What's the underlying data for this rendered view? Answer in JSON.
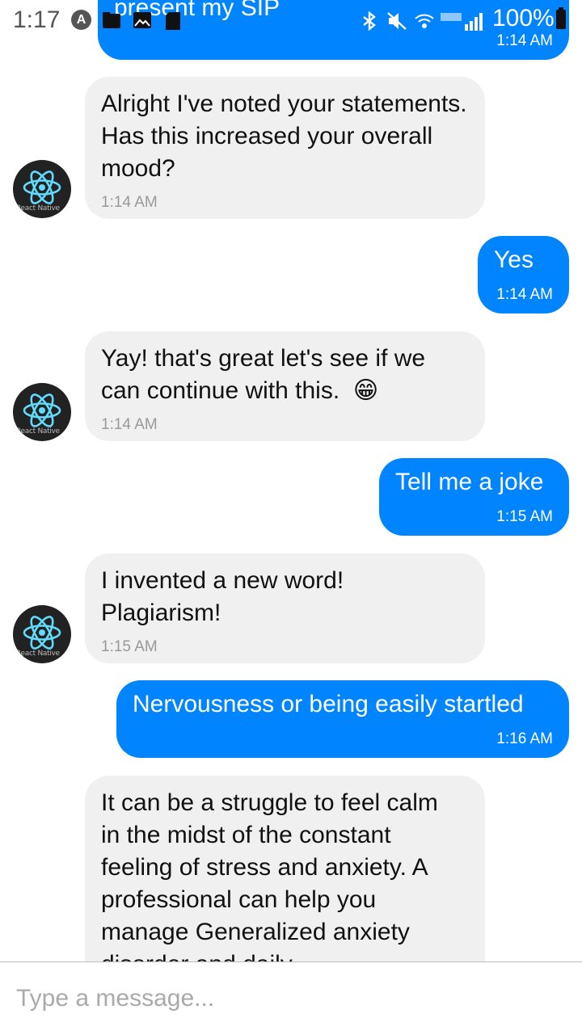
{
  "status_bar": {
    "time": "1:17",
    "notification_badge": "A",
    "battery": "100%",
    "icons": [
      "photo-icon",
      "image-icon",
      "sd-card-icon",
      "bluetooth-icon",
      "mute-icon",
      "wifi-icon",
      "signal-icon",
      "battery-icon"
    ]
  },
  "messages": [
    {
      "from": "user",
      "text": "present my SIP",
      "time": "1:14 AM"
    },
    {
      "from": "bot",
      "text": "Alright I've noted your statements. Has this increased your overall mood?",
      "time": "1:14 AM"
    },
    {
      "from": "user",
      "text": "Yes",
      "time": "1:14 AM"
    },
    {
      "from": "bot",
      "text": "Yay! that's great let's see if we can continue with this.",
      "emoji": "😁",
      "time": "1:14 AM"
    },
    {
      "from": "user",
      "text": "Tell me a joke",
      "time": "1:15 AM"
    },
    {
      "from": "bot",
      "text": "I invented a new word! Plagiarism!",
      "time": "1:15 AM"
    },
    {
      "from": "user",
      "text": "Nervousness or being easily startled",
      "time": "1:16 AM"
    },
    {
      "from": "bot",
      "text": "It can be a struggle to feel calm in the midst of the constant feeling of stress and anxiety. A professional can help you manage Generalized anxiety disorder and daily"
    }
  ],
  "avatar": {
    "caption": "React Native"
  },
  "composer": {
    "placeholder": "Type a message..."
  },
  "colors": {
    "outgoing_bubble": "#0084ff",
    "incoming_bubble": "#f0f0f0",
    "avatar_logo": "#61dafb"
  }
}
